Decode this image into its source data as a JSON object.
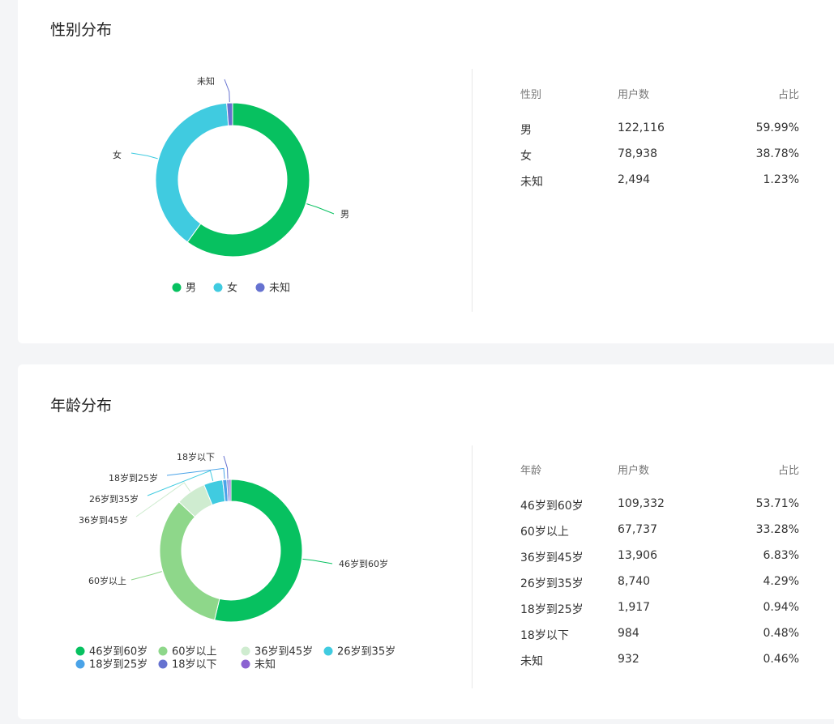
{
  "colors": {
    "green": "#07c160",
    "light_green": "#8ed78a",
    "pale_green": "#cfecd0",
    "cyan": "#40cbe0",
    "blue": "#4aa3e8",
    "indigo": "#6672d0",
    "purple": "#8b62d1"
  },
  "gender": {
    "title": "性别分布",
    "table": {
      "headers": [
        "性别",
        "用户数",
        "占比"
      ],
      "rows": [
        {
          "label": "男",
          "count": "122,116",
          "pct": "59.99%"
        },
        {
          "label": "女",
          "count": "78,938",
          "pct": "38.78%"
        },
        {
          "label": "未知",
          "count": "2,494",
          "pct": "1.23%"
        }
      ]
    }
  },
  "age": {
    "title": "年龄分布",
    "table": {
      "headers": [
        "年龄",
        "用户数",
        "占比"
      ],
      "rows": [
        {
          "label": "46岁到60岁",
          "count": "109,332",
          "pct": "53.71%"
        },
        {
          "label": "60岁以上",
          "count": "67,737",
          "pct": "33.28%"
        },
        {
          "label": "36岁到45岁",
          "count": "13,906",
          "pct": "6.83%"
        },
        {
          "label": "26岁到35岁",
          "count": "8,740",
          "pct": "4.29%"
        },
        {
          "label": "18岁到25岁",
          "count": "1,917",
          "pct": "0.94%"
        },
        {
          "label": "18岁以下",
          "count": "984",
          "pct": "0.48%"
        },
        {
          "label": "未知",
          "count": "932",
          "pct": "0.46%"
        }
      ]
    }
  },
  "chart_data": [
    {
      "type": "pie",
      "donut": true,
      "title": "性别分布",
      "categories": [
        "男",
        "女",
        "未知"
      ],
      "values": [
        59.99,
        38.78,
        1.23
      ],
      "colors": [
        "#07c160",
        "#40cbe0",
        "#6672d0"
      ],
      "slice_labels": [
        "男",
        "女",
        "未知"
      ],
      "legend": [
        "男",
        "女",
        "未知"
      ],
      "legend_placement": "bottom"
    },
    {
      "type": "pie",
      "donut": true,
      "title": "年龄分布",
      "categories": [
        "46岁到60岁",
        "60岁以上",
        "36岁到45岁",
        "26岁到35岁",
        "18岁到25岁",
        "18岁以下",
        "未知"
      ],
      "values": [
        53.71,
        33.28,
        6.83,
        4.29,
        0.94,
        0.48,
        0.46
      ],
      "colors": [
        "#07c160",
        "#8ed78a",
        "#cfecd0",
        "#40cbe0",
        "#4aa3e8",
        "#6672d0",
        "#8b62d1"
      ],
      "slice_labels": [
        "46岁到60岁",
        "60岁以上",
        "36岁到45岁",
        "26岁到35岁",
        "18岁到25岁",
        "18岁以下"
      ],
      "legend": [
        "46岁到60岁",
        "60岁以上",
        "36岁到45岁",
        "26岁到35岁",
        "18岁到25岁",
        "18岁以下",
        "未知"
      ],
      "legend_placement": "bottom"
    }
  ]
}
